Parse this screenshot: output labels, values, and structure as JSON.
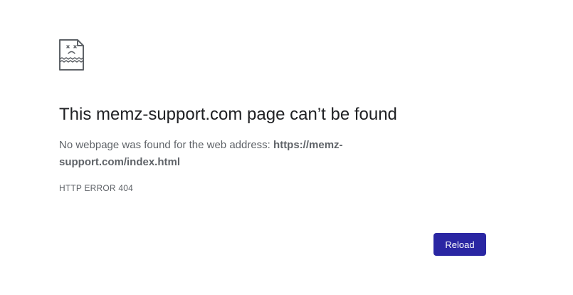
{
  "page": {
    "title": "This memz-support.com page can’t be found",
    "message_prefix": "No webpage was found for the web address: ",
    "url": "https://memz-support.com/index.html",
    "error_code": "HTTP ERROR 404",
    "reload_label": "Reload",
    "icon": "sad-document-icon"
  },
  "colors": {
    "button_bg": "#2a26a3",
    "title_text": "#202124",
    "body_text": "#5f6368"
  }
}
